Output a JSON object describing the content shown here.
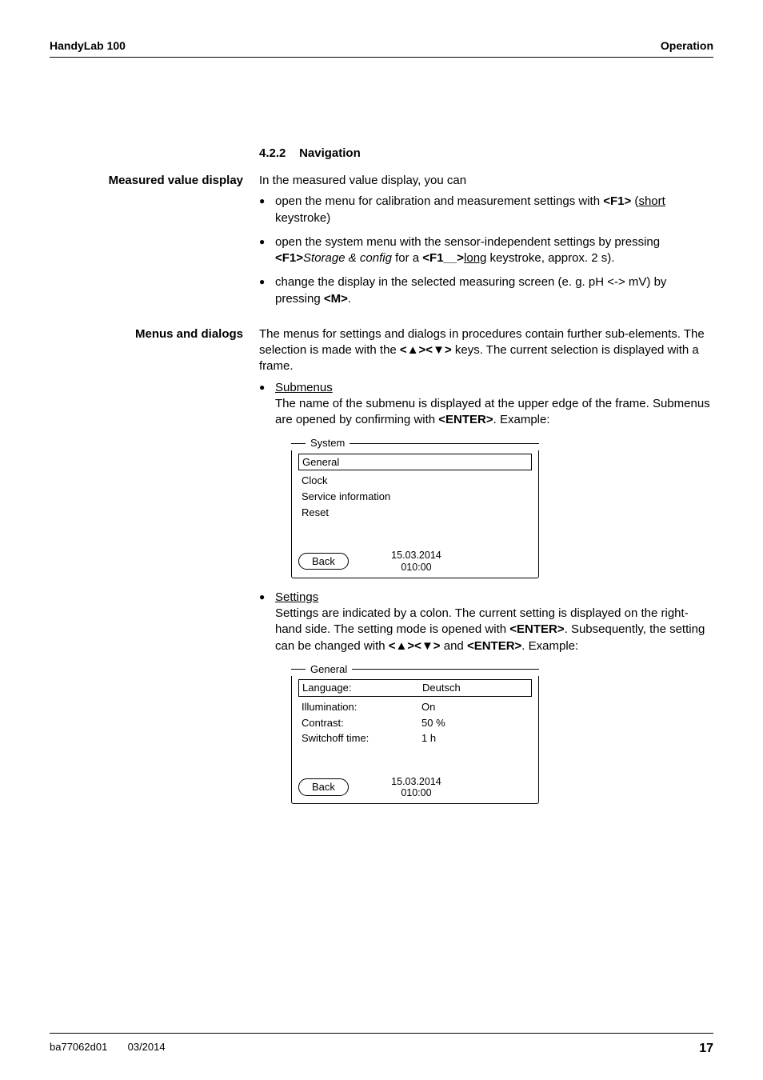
{
  "header": {
    "left": "HandyLab 100",
    "right": "Operation"
  },
  "section": {
    "number": "4.2.2",
    "title": "Navigation"
  },
  "mvd": {
    "label": "Measured value display",
    "intro": "In the measured value display, you can",
    "b1a": "open the menu for calibration and measurement settings with ",
    "b1b": "<F1>",
    "b1c": " (",
    "b1d": "short ",
    "b1e": "keystroke)",
    "b2a": "open the system menu with the sensor-independent settings by pressing ",
    "b2b": "<F1>",
    "b2c": "Storage & config",
    "b2d": " for a ",
    "b2e": "<F1__>",
    "b2f": "long",
    "b2g": " keystroke, approx. 2 s).",
    "b3a": "change the display in the selected measuring screen (e. g. pH <-> mV) by pressing ",
    "b3b": "<M>",
    "b3c": "."
  },
  "mad": {
    "label": "Menus and dialogs",
    "p1a": "The menus for settings and dialogs in procedures contain further sub-elements. The selection is made with the ",
    "p1b": "<",
    "p1c": "><",
    "p1d": ">",
    "p1e": " keys. The current selection is displayed with a frame.",
    "sm_title": "Submenus",
    "sm_a": "The name of the submenu is displayed at the upper edge of the frame. Submenus are opened by confirming with ",
    "sm_b": "<ENTER>",
    "sm_c": ". Example:",
    "st_title": "Settings",
    "st_a": "Settings are indicated by a colon. The current setting is displayed on the right-hand side. The setting mode is opened with ",
    "st_b": "<ENTER>",
    "st_c": ". Subsequently, the setting can be changed with ",
    "st_d": "<",
    "st_e": "><",
    "st_f": ">",
    "st_g": " and ",
    "st_h": "<ENTER>",
    "st_i": ". Example:"
  },
  "screen1": {
    "title": "System",
    "selected": "General",
    "lines": [
      "Clock",
      "Service information",
      "Reset"
    ],
    "back": "Back",
    "date": "15.03.2014",
    "time": "010:00"
  },
  "screen2": {
    "title": "General",
    "rows": [
      {
        "k": "Language:",
        "v": "Deutsch",
        "sel": true
      },
      {
        "k": "Illumination:",
        "v": "On",
        "sel": false
      },
      {
        "k": "Contrast:",
        "v": "50 %",
        "sel": false
      },
      {
        "k": "Switchoff time:",
        "v": "1 h",
        "sel": false
      }
    ],
    "back": "Back",
    "date": "15.03.2014",
    "time": "010:00"
  },
  "footer": {
    "left1": "ba77062d01",
    "left2": "03/2014",
    "page": "17"
  }
}
